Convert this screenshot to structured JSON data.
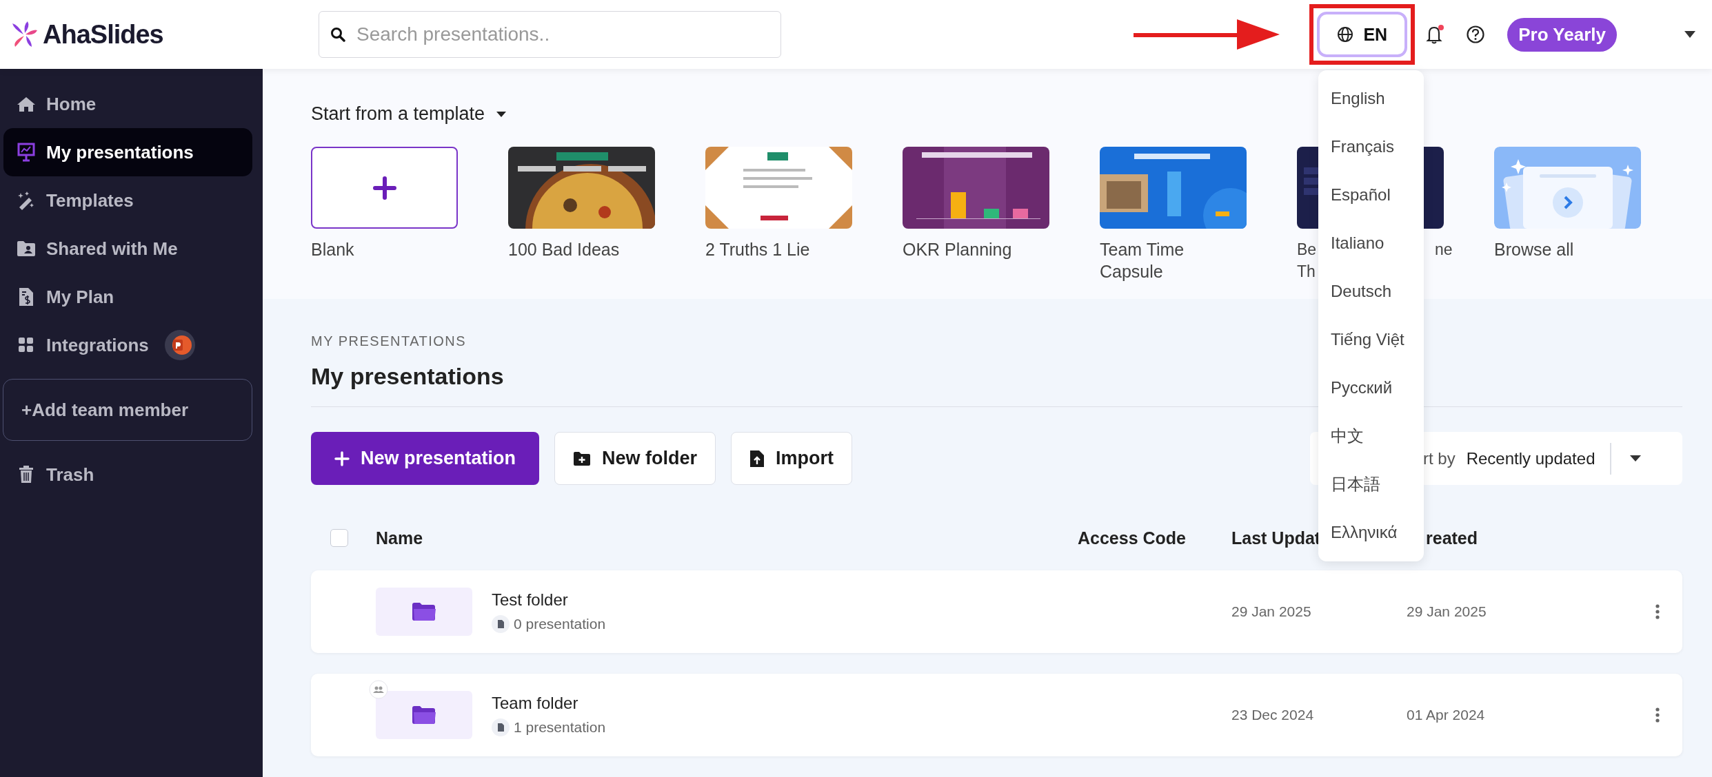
{
  "logo": {
    "name": "AhaSlides"
  },
  "search": {
    "placeholder": "Search presentations.."
  },
  "language_button": {
    "label": "EN",
    "highlighted": true
  },
  "notifications": {
    "unread": true
  },
  "plan_badge": "Pro Yearly",
  "sidebar": {
    "items": [
      {
        "label": "Home",
        "kind": "link",
        "selected": false
      },
      {
        "label": "My presentations",
        "kind": "link",
        "selected": true
      },
      {
        "label": "Templates",
        "kind": "link",
        "selected": false
      },
      {
        "label": "Shared with Me",
        "kind": "link",
        "selected": false
      },
      {
        "label": "My Plan",
        "kind": "link",
        "selected": false
      },
      {
        "label": "Integrations",
        "kind": "integration",
        "selected": false
      },
      {
        "label": "+Add team member",
        "kind": "button"
      },
      {
        "label": "Trash",
        "kind": "link",
        "selected": false
      }
    ]
  },
  "templates": {
    "title": "Start from a template",
    "items": [
      {
        "kind": "blank",
        "label": "Blank"
      },
      {
        "kind": "picture",
        "label": "100 Bad Ideas"
      },
      {
        "kind": "picture",
        "label": "2 Truths 1 Lie"
      },
      {
        "kind": "picture",
        "label": "OKR Planning"
      },
      {
        "kind": "picture",
        "label": "Team Time Capsule"
      },
      {
        "kind": "picture",
        "label_parts": [
          "Be",
          "ne",
          "Th"
        ]
      },
      {
        "kind": "browse",
        "label": "Browse all"
      }
    ]
  },
  "language_menu": {
    "items": [
      "English",
      "Français",
      "Español",
      "Italiano",
      "Deutsch",
      "Tiếng Việt",
      "Русский",
      "中文",
      "日本語",
      "Ελληνικά"
    ]
  },
  "section": {
    "overline": "MY PRESENTATIONS",
    "title": "My presentations"
  },
  "actions": [
    {
      "label": "New presentation",
      "kind": "primary"
    },
    {
      "label": "New folder",
      "kind": "secondary"
    },
    {
      "label": "Import",
      "kind": "secondary"
    }
  ],
  "sort": {
    "label": "rt by",
    "value": "Recently updated"
  },
  "table": {
    "select_all": {
      "checked": false
    },
    "columns": [
      "Name",
      "Access Code",
      "Last Updat",
      "reated"
    ],
    "rows": [
      {
        "name": "Test folder",
        "count": "0 presentation",
        "last_updated": "29 Jan 2025",
        "created": "29 Jan 2025",
        "shared": false
      },
      {
        "name": "Team folder",
        "count": "1 presentation",
        "last_updated": "23 Dec 2024",
        "created": "01 Apr 2024",
        "shared": true
      }
    ]
  }
}
